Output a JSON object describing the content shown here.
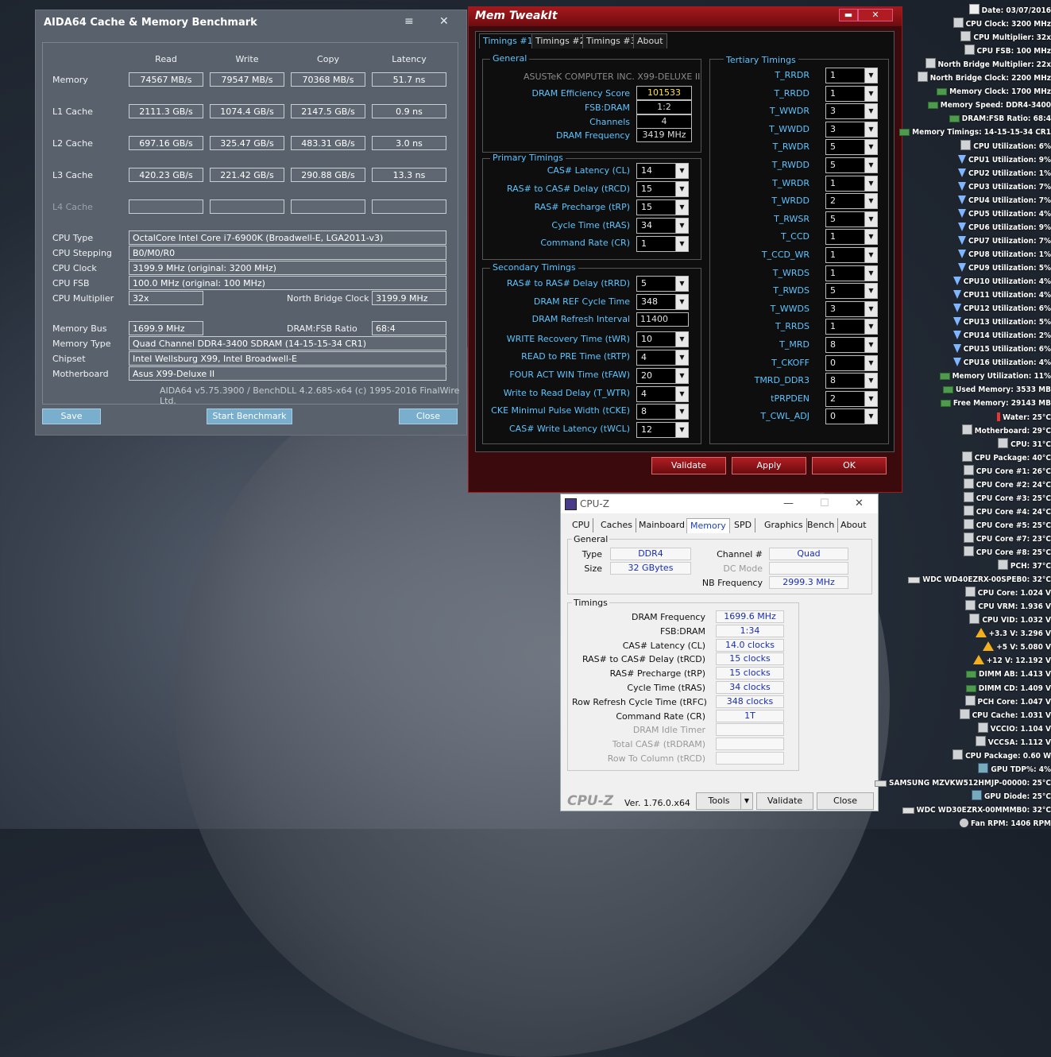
{
  "aida": {
    "title": "AIDA64 Cache & Memory Benchmark",
    "headers": [
      "Read",
      "Write",
      "Copy",
      "Latency"
    ],
    "rows": [
      {
        "label": "Memory",
        "values": [
          "74567 MB/s",
          "79547 MB/s",
          "70368 MB/s",
          "51.7 ns"
        ]
      },
      {
        "label": "L1 Cache",
        "values": [
          "2111.3 GB/s",
          "1074.4 GB/s",
          "2147.5 GB/s",
          "0.9 ns"
        ]
      },
      {
        "label": "L2 Cache",
        "values": [
          "697.16 GB/s",
          "325.47 GB/s",
          "483.31 GB/s",
          "3.0 ns"
        ]
      },
      {
        "label": "L3 Cache",
        "values": [
          "420.23 GB/s",
          "221.42 GB/s",
          "290.88 GB/s",
          "13.3 ns"
        ]
      },
      {
        "label": "L4 Cache",
        "values": [
          "",
          "",
          "",
          ""
        ]
      }
    ],
    "info": {
      "cpu_type_label": "CPU Type",
      "cpu_type": "OctalCore Intel Core i7-6900K  (Broadwell-E, LGA2011-v3)",
      "cpu_stepping_label": "CPU Stepping",
      "cpu_stepping": "B0/M0/R0",
      "cpu_clock_label": "CPU Clock",
      "cpu_clock": "3199.9 MHz  (original: 3200 MHz)",
      "cpu_fsb_label": "CPU FSB",
      "cpu_fsb": "100.0 MHz  (original: 100 MHz)",
      "cpu_mult_label": "CPU Multiplier",
      "cpu_mult": "32x",
      "nb_clock_label": "North Bridge Clock",
      "nb_clock": "3199.9 MHz",
      "mem_bus_label": "Memory Bus",
      "mem_bus": "1699.9 MHz",
      "dram_fsb_label": "DRAM:FSB Ratio",
      "dram_fsb": "68:4",
      "mem_type_label": "Memory Type",
      "mem_type": "Quad Channel DDR4-3400 SDRAM  (14-15-15-34 CR1)",
      "chipset_label": "Chipset",
      "chipset": "Intel Wellsburg X99, Intel Broadwell-E",
      "mobo_label": "Motherboard",
      "mobo": "Asus X99-Deluxe II"
    },
    "footer": "AIDA64 v5.75.3900 / BenchDLL 4.2.685-x64  (c) 1995-2016 FinalWire Ltd.",
    "buttons": {
      "save": "Save",
      "start": "Start Benchmark",
      "close": "Close"
    }
  },
  "mti": {
    "title": "Mem TweakIt",
    "tabs": [
      "Timings #1",
      "Timings #2",
      "Timings #3",
      "About"
    ],
    "general": {
      "title": "General",
      "board": "ASUSTeK COMPUTER INC. X99-DELUXE II",
      "eff_label": "DRAM Efficiency Score",
      "eff": "101533",
      "fsb_label": "FSB:DRAM",
      "fsb": "1:2",
      "ch_label": "Channels",
      "ch": "4",
      "freq_label": "DRAM Frequency",
      "freq": "3419 MHz"
    },
    "primary": {
      "title": "Primary Timings",
      "items": [
        {
          "label": "CAS# Latency (CL)",
          "value": "14"
        },
        {
          "label": "RAS# to CAS# Delay (tRCD)",
          "value": "15"
        },
        {
          "label": "RAS# Precharge (tRP)",
          "value": "15"
        },
        {
          "label": "Cycle Time (tRAS)",
          "value": "34"
        },
        {
          "label": "Command Rate (CR)",
          "value": "1"
        }
      ]
    },
    "secondary": {
      "title": "Secondary Timings",
      "items": [
        {
          "label": "RAS# to RAS# Delay (tRRD)",
          "value": "5"
        },
        {
          "label": "DRAM REF Cycle Time",
          "value": "348"
        },
        {
          "label": "DRAM Refresh Interval",
          "value": "11400"
        },
        {
          "label": "WRITE Recovery Time (tWR)",
          "value": "10"
        },
        {
          "label": "READ to PRE Time (tRTP)",
          "value": "4"
        },
        {
          "label": "FOUR ACT WIN Time (tFAW)",
          "value": "20"
        },
        {
          "label": "Write to Read Delay (T_WTR)",
          "value": "4"
        },
        {
          "label": "CKE Minimul Pulse Width (tCKE)",
          "value": "8"
        },
        {
          "label": "CAS# Write Latency (tWCL)",
          "value": "12"
        }
      ]
    },
    "tertiary": {
      "title": "Tertiary Timings",
      "items": [
        {
          "label": "T_RRDR",
          "value": "1"
        },
        {
          "label": "T_RRDD",
          "value": "1"
        },
        {
          "label": "T_WWDR",
          "value": "3"
        },
        {
          "label": "T_WWDD",
          "value": "3"
        },
        {
          "label": "T_RWDR",
          "value": "5"
        },
        {
          "label": "T_RWDD",
          "value": "5"
        },
        {
          "label": "T_WRDR",
          "value": "1"
        },
        {
          "label": "T_WRDD",
          "value": "2"
        },
        {
          "label": "T_RWSR",
          "value": "5"
        },
        {
          "label": "T_CCD",
          "value": "1"
        },
        {
          "label": "T_CCD_WR",
          "value": "1"
        },
        {
          "label": "T_WRDS",
          "value": "1"
        },
        {
          "label": "T_RWDS",
          "value": "5"
        },
        {
          "label": "T_WWDS",
          "value": "3"
        },
        {
          "label": "T_RRDS",
          "value": "1"
        },
        {
          "label": "T_MRD",
          "value": "8"
        },
        {
          "label": "T_CKOFF",
          "value": "0"
        },
        {
          "label": "TMRD_DDR3",
          "value": "8"
        },
        {
          "label": "tPRPDEN",
          "value": "2"
        },
        {
          "label": "T_CWL_ADJ",
          "value": "0"
        }
      ]
    },
    "buttons": {
      "validate": "Validate",
      "apply": "Apply",
      "ok": "OK"
    }
  },
  "cpuz": {
    "title": "CPU-Z",
    "tabs": [
      "CPU",
      "Caches",
      "Mainboard",
      "Memory",
      "SPD",
      "Graphics",
      "Bench",
      "About"
    ],
    "general": {
      "title": "General",
      "type_label": "Type",
      "type": "DDR4",
      "size_label": "Size",
      "size": "32 GBytes",
      "channel_label": "Channel #",
      "channel": "Quad",
      "dc_label": "DC Mode",
      "dc": "",
      "nb_label": "NB Frequency",
      "nb": "2999.3 MHz"
    },
    "timings": {
      "title": "Timings",
      "items": [
        {
          "label": "DRAM Frequency",
          "value": "1699.6 MHz"
        },
        {
          "label": "FSB:DRAM",
          "value": "1:34"
        },
        {
          "label": "CAS# Latency (CL)",
          "value": "14.0 clocks"
        },
        {
          "label": "RAS# to CAS# Delay (tRCD)",
          "value": "15 clocks"
        },
        {
          "label": "RAS# Precharge (tRP)",
          "value": "15 clocks"
        },
        {
          "label": "Cycle Time (tRAS)",
          "value": "34 clocks"
        },
        {
          "label": "Row Refresh Cycle Time (tRFC)",
          "value": "348 clocks"
        },
        {
          "label": "Command Rate (CR)",
          "value": "1T"
        },
        {
          "label": "DRAM Idle Timer",
          "value": ""
        },
        {
          "label": "Total CAS# (tRDRAM)",
          "value": ""
        },
        {
          "label": "Row To Column (tRCD)",
          "value": ""
        }
      ]
    },
    "logo": "CPU-Z",
    "version": "Ver. 1.76.0.x64",
    "buttons": {
      "tools": "Tools",
      "validate": "Validate",
      "close": "Close"
    }
  },
  "sensors": [
    {
      "icon": "calendar",
      "text": "Date: 03/07/2016"
    },
    {
      "icon": "chip",
      "text": "CPU Clock: 3200 MHz"
    },
    {
      "icon": "chip",
      "text": "CPU Multiplier: 32x"
    },
    {
      "icon": "chip",
      "text": "CPU FSB: 100 MHz"
    },
    {
      "icon": "chip",
      "text": "North Bridge Multiplier: 22x"
    },
    {
      "icon": "chip",
      "text": "North Bridge Clock: 2200 MHz"
    },
    {
      "icon": "memory",
      "text": "Memory Clock: 1700 MHz"
    },
    {
      "icon": "memory",
      "text": "Memory Speed: DDR4-3400"
    },
    {
      "icon": "memory",
      "text": "DRAM:FSB Ratio: 68:4"
    },
    {
      "icon": "memory",
      "text": "Memory Timings: 14-15-15-34 CR1"
    },
    {
      "icon": "chip",
      "text": "CPU Utilization: 6%"
    },
    {
      "icon": "hourglass",
      "text": "CPU1 Utilization: 9%"
    },
    {
      "icon": "hourglass",
      "text": "CPU2 Utilization: 1%"
    },
    {
      "icon": "hourglass",
      "text": "CPU3 Utilization: 7%"
    },
    {
      "icon": "hourglass",
      "text": "CPU4 Utilization: 7%"
    },
    {
      "icon": "hourglass",
      "text": "CPU5 Utilization: 4%"
    },
    {
      "icon": "hourglass",
      "text": "CPU6 Utilization: 9%"
    },
    {
      "icon": "hourglass",
      "text": "CPU7 Utilization: 7%"
    },
    {
      "icon": "hourglass",
      "text": "CPU8 Utilization: 1%"
    },
    {
      "icon": "hourglass",
      "text": "CPU9 Utilization: 5%"
    },
    {
      "icon": "hourglass",
      "text": "CPU10 Utilization: 4%"
    },
    {
      "icon": "hourglass",
      "text": "CPU11 Utilization: 4%"
    },
    {
      "icon": "hourglass",
      "text": "CPU12 Utilization: 6%"
    },
    {
      "icon": "hourglass",
      "text": "CPU13 Utilization: 5%"
    },
    {
      "icon": "hourglass",
      "text": "CPU14 Utilization: 2%"
    },
    {
      "icon": "hourglass",
      "text": "CPU15 Utilization: 6%"
    },
    {
      "icon": "hourglass",
      "text": "CPU16 Utilization: 4%"
    },
    {
      "icon": "memory",
      "text": "Memory Utilization: 11%"
    },
    {
      "icon": "memory",
      "text": "Used Memory: 3533 MB"
    },
    {
      "icon": "memory",
      "text": "Free Memory: 29143 MB"
    },
    {
      "icon": "thermometer",
      "text": "Water: 25°C"
    },
    {
      "icon": "chip",
      "text": "Motherboard: 29°C"
    },
    {
      "icon": "chip",
      "text": "CPU: 31°C"
    },
    {
      "icon": "chip",
      "text": "CPU Package: 40°C"
    },
    {
      "icon": "chip",
      "text": "CPU Core #1: 26°C"
    },
    {
      "icon": "chip",
      "text": "CPU Core #2: 24°C"
    },
    {
      "icon": "chip",
      "text": "CPU Core #3: 25°C"
    },
    {
      "icon": "chip",
      "text": "CPU Core #4: 24°C"
    },
    {
      "icon": "chip",
      "text": "CPU Core #5: 25°C"
    },
    {
      "icon": "chip",
      "text": "CPU Core #7: 23°C"
    },
    {
      "icon": "chip",
      "text": "CPU Core #8: 25°C"
    },
    {
      "icon": "chip",
      "text": "PCH: 37°C"
    },
    {
      "icon": "disk",
      "text": "WDC WD40EZRX-00SPEB0: 32°C"
    },
    {
      "icon": "chip",
      "text": "CPU Core: 1.024 V"
    },
    {
      "icon": "chip",
      "text": "CPU VRM: 1.936 V"
    },
    {
      "icon": "chip",
      "text": "CPU VID: 1.032 V"
    },
    {
      "icon": "warning",
      "text": "+3.3 V: 3.296 V"
    },
    {
      "icon": "warning",
      "text": "+5 V: 5.080 V"
    },
    {
      "icon": "warning",
      "text": "+12 V: 12.192 V"
    },
    {
      "icon": "memory",
      "text": "DIMM AB: 1.413 V"
    },
    {
      "icon": "memory",
      "text": "DIMM CD: 1.409 V"
    },
    {
      "icon": "chip",
      "text": "PCH Core: 1.047 V"
    },
    {
      "icon": "chip",
      "text": "CPU Cache: 1.031 V"
    },
    {
      "icon": "chip",
      "text": "VCCIO: 1.104 V"
    },
    {
      "icon": "chip",
      "text": "VCCSA: 1.112 V"
    },
    {
      "icon": "chip",
      "text": "CPU Package: 0.60 W"
    },
    {
      "icon": "gpu",
      "text": "GPU TDP%: 4%"
    },
    {
      "icon": "disk",
      "text": "SAMSUNG MZVKW512HMJP-00000: 25°C"
    },
    {
      "icon": "gpu",
      "text": "GPU Diode: 25°C"
    },
    {
      "icon": "disk",
      "text": "WDC WD30EZRX-00MMMB0: 32°C"
    },
    {
      "icon": "fan",
      "text": "Fan RPM: 1406 RPM"
    }
  ]
}
